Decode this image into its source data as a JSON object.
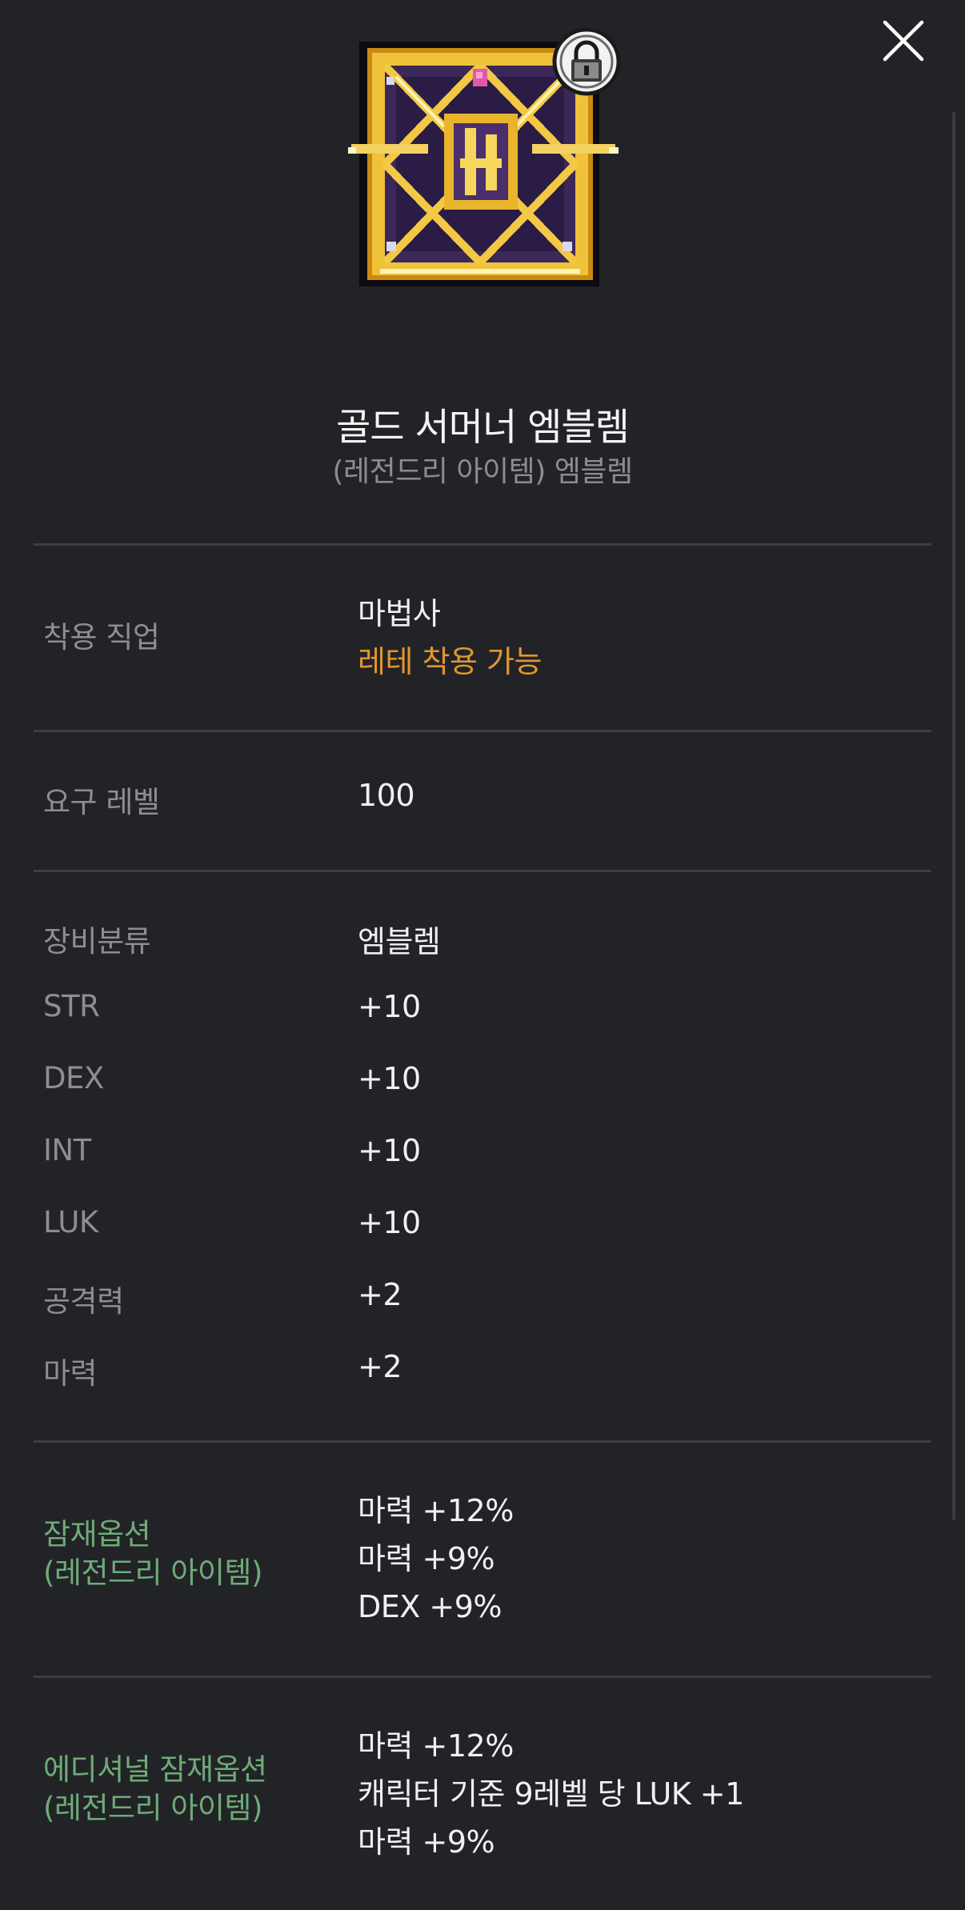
{
  "item": {
    "name": "골드 서머너 엠블렘",
    "subtitle": "(레전드리 아이템) 엠블렘"
  },
  "colors": {
    "background": "#222327",
    "accent_orange": "#e2962e",
    "potential_green": "#6eab77",
    "label_gray": "#8d8e93"
  },
  "icons": {
    "close": "close-icon",
    "item": "gold-summoner-emblem-icon",
    "lock": "lock-icon"
  },
  "job": {
    "label": "착용 직업",
    "value": "마법사",
    "note": "레테 착용 가능"
  },
  "level": {
    "label": "요구 레벨",
    "value": "100"
  },
  "stats": [
    {
      "label": "장비분류",
      "value": "엠블렘"
    },
    {
      "label": "STR",
      "value": "+10"
    },
    {
      "label": "DEX",
      "value": "+10"
    },
    {
      "label": "INT",
      "value": "+10"
    },
    {
      "label": "LUK",
      "value": "+10"
    },
    {
      "label": "공격력",
      "value": "+2"
    },
    {
      "label": "마력",
      "value": "+2"
    }
  ],
  "potential": {
    "label_line1": "잠재옵션",
    "label_line2": "(레전드리 아이템)",
    "lines": [
      "마력 +12%",
      "마력 +9%",
      "DEX +9%"
    ]
  },
  "additional": {
    "label_line1": "에디셔널 잠재옵션",
    "label_line2": "(레전드리 아이템)",
    "lines": [
      "마력 +12%",
      "캐릭터 기준 9레벨 당 LUK +1",
      "마력 +9%"
    ]
  }
}
